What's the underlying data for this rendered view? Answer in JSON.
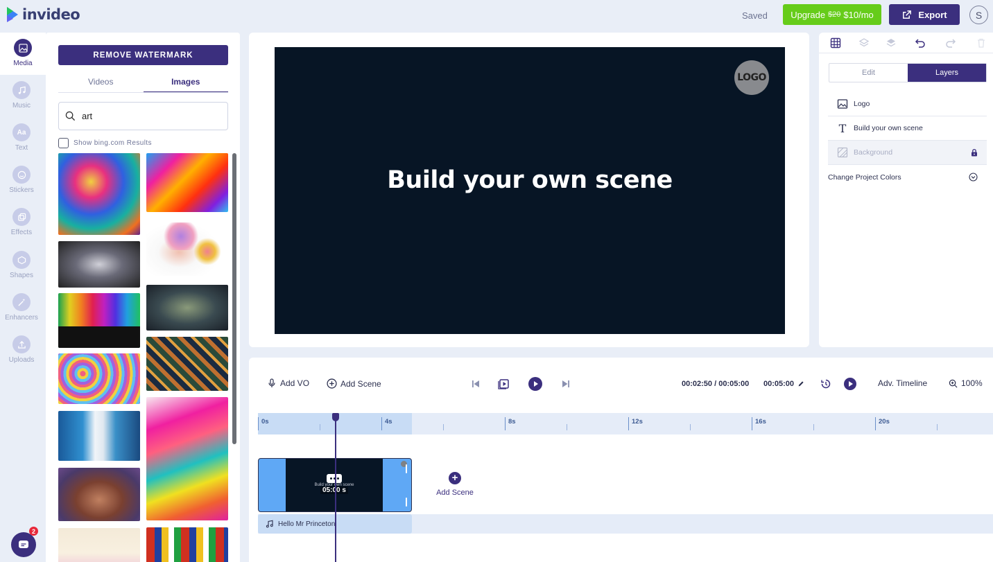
{
  "header": {
    "brand": "invideo",
    "status": "Saved",
    "upgrade": {
      "label": "Upgrade",
      "old_price": "$20",
      "new_price": "$10/mo"
    },
    "export_label": "Export",
    "avatar_initial": "S"
  },
  "rail": {
    "items": [
      {
        "label": "Media",
        "icon": "image-icon"
      },
      {
        "label": "Music",
        "icon": "music-icon"
      },
      {
        "label": "Text",
        "icon": "text-icon"
      },
      {
        "label": "Stickers",
        "icon": "sticker-icon"
      },
      {
        "label": "Effects",
        "icon": "effects-icon"
      },
      {
        "label": "Shapes",
        "icon": "shapes-icon"
      },
      {
        "label": "Enhancers",
        "icon": "wand-icon"
      },
      {
        "label": "Uploads",
        "icon": "upload-icon"
      }
    ],
    "chat_badge": "2"
  },
  "media": {
    "remove_watermark": "REMOVE WATERMARK",
    "tabs": [
      "Videos",
      "Images"
    ],
    "active_tab": "Images",
    "search_value": "art",
    "bing_label": "Show bing.com Results"
  },
  "canvas": {
    "title": "Build your own scene",
    "logo": "LOGO",
    "background": "#071525"
  },
  "right_panel": {
    "tabs": [
      "Edit",
      "Layers"
    ],
    "active_tab": "Layers",
    "layers": [
      {
        "label": "Logo",
        "icon": "image-icon"
      },
      {
        "label": "Build your own scene",
        "icon": "text-icon"
      },
      {
        "label": "Background",
        "icon": "background-icon",
        "locked": true
      },
      {
        "label": "Change Project Colors",
        "icon": "chevron-down-icon"
      }
    ]
  },
  "timeline": {
    "add_vo": "Add VO",
    "add_scene": "Add Scene",
    "time": "00:02:50 / 00:05:00",
    "duration": "00:05:00",
    "adv_timeline": "Adv. Timeline",
    "zoom": "100%",
    "ticks": [
      "0s",
      "4s",
      "8s",
      "12s",
      "16s",
      "20s"
    ],
    "scene_title": "Build your own scene",
    "scene_duration": "05:00 s",
    "add_scene_label": "Add Scene",
    "audio_track": "Hello Mr Princeton"
  },
  "colors": {
    "brand": "#3b2f7e",
    "upgrade": "#66cc1a",
    "canvas": "#071525",
    "clip": "#5fa8f5"
  }
}
